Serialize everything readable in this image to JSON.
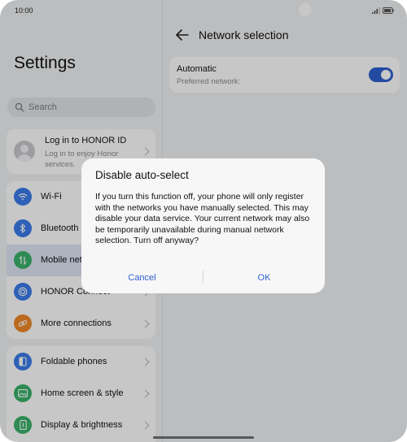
{
  "status_bar": {
    "time": "10:00"
  },
  "settings": {
    "title": "Settings",
    "search_placeholder": "Search",
    "account": {
      "title": "Log in to HONOR ID",
      "subtitle": "Log in to enjoy Honor services."
    },
    "group1": [
      {
        "label": "Wi-Fi",
        "icon": "wifi-icon",
        "color": "#3a7bea"
      },
      {
        "label": "Bluetooth",
        "icon": "bluetooth-icon",
        "color": "#3a7bea"
      },
      {
        "label": "Mobile network",
        "icon": "mobile-network-icon",
        "color": "#3ab36b"
      },
      {
        "label": "HONOR Connect",
        "icon": "honor-connect-icon",
        "color": "#3a7bea"
      },
      {
        "label": "More connections",
        "icon": "link-icon",
        "color": "#f08a2a"
      }
    ],
    "group2": [
      {
        "label": "Foldable phones",
        "icon": "foldable-icon",
        "color": "#3a7bea"
      },
      {
        "label": "Home screen & style",
        "icon": "image-icon",
        "color": "#3ab36b"
      },
      {
        "label": "Display & brightness",
        "icon": "display-icon",
        "color": "#3ab36b"
      }
    ]
  },
  "network": {
    "title": "Network selection",
    "automatic": {
      "title": "Automatic",
      "subtitle": "Preferred network:",
      "enabled": true
    }
  },
  "dialog": {
    "title": "Disable auto-select",
    "body": "If you turn this function off, your phone will only register with the networks you have manually selected. This may disable your data service. Your current network may also be temporarily unavailable during manual network selection. Turn off anyway?",
    "cancel": "Cancel",
    "ok": "OK"
  },
  "colors": {
    "accent": "#2f5fd0",
    "selected_row": "#dfe6f7"
  }
}
